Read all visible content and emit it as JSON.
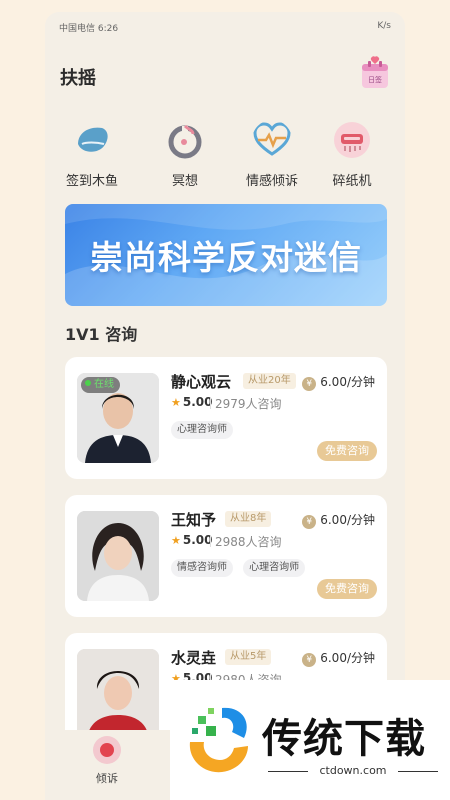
{
  "status_bar": {
    "carrier": "中国电信 6:26",
    "right": "K/s"
  },
  "header": {
    "title": "扶摇",
    "calendar_label": "日签"
  },
  "quick_actions": [
    {
      "label": "签到木鱼",
      "icon": "wooden-fish-icon"
    },
    {
      "label": "冥想",
      "icon": "meditation-icon"
    },
    {
      "label": "情感倾诉",
      "icon": "heartbeat-icon"
    },
    {
      "label": "碎纸机",
      "icon": "shredder-icon"
    }
  ],
  "banner": {
    "text": "崇尚科学反对迷信"
  },
  "section": {
    "title": "1V1 咨询"
  },
  "counselors": [
    {
      "name": "静心观云",
      "experience": "从业20年",
      "price": "6.00/分钟",
      "rating": "5.00",
      "consults": "2979人咨询",
      "tags": [
        "心理咨询师"
      ],
      "online": "在线",
      "action": "免费咨询"
    },
    {
      "name": "王知予",
      "experience": "从业8年",
      "price": "6.00/分钟",
      "rating": "5.00",
      "consults": "2988人咨询",
      "tags": [
        "情感咨询师",
        "心理咨询师"
      ],
      "action": "免费咨询"
    },
    {
      "name": "水灵垚",
      "experience": "从业5年",
      "price": "6.00/分钟",
      "rating": "5.00",
      "consults": "2980人咨询",
      "tags": [],
      "action": ""
    }
  ],
  "tabbar": {
    "items": [
      {
        "label": "倾诉"
      }
    ]
  },
  "watermark": {
    "title": "传统下载",
    "url": "ctdown.com"
  },
  "colors": {
    "accent": "#e8c996",
    "banner": "#3a82e6",
    "background": "#f4efe6"
  }
}
